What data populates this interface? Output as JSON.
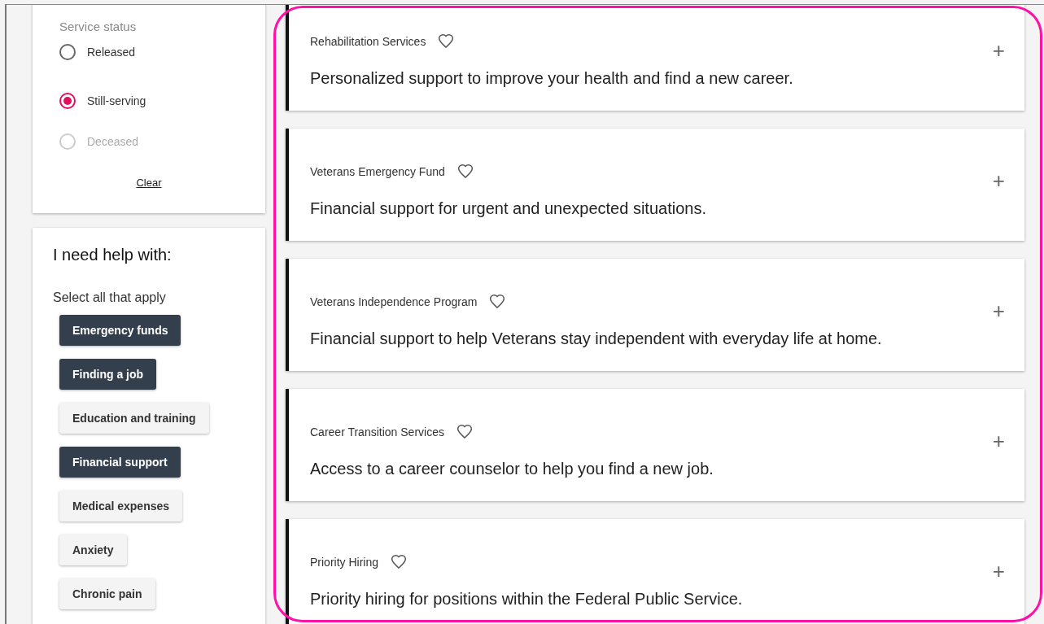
{
  "service_status": {
    "label": "Service status",
    "options": [
      {
        "label": "Released",
        "selected": false,
        "disabled": false
      },
      {
        "label": "Still-serving",
        "selected": true,
        "disabled": false
      },
      {
        "label": "Deceased",
        "selected": false,
        "disabled": true
      }
    ],
    "clear": "Clear"
  },
  "help": {
    "title": "I need help with:",
    "hint": "Select all that apply",
    "chips": [
      {
        "label": "Emergency funds",
        "selected": true
      },
      {
        "label": "Finding a job",
        "selected": true
      },
      {
        "label": "Education and training",
        "selected": false
      },
      {
        "label": "Financial support",
        "selected": true
      },
      {
        "label": "Medical expenses",
        "selected": false
      },
      {
        "label": "Anxiety",
        "selected": false
      },
      {
        "label": "Chronic pain",
        "selected": false
      }
    ]
  },
  "results": [
    {
      "title": "Rehabilitation Services",
      "favorite": false,
      "description": "Personalized support to improve your health and find a new career.",
      "expand": "+"
    },
    {
      "title": "Veterans Emergency Fund",
      "favorite": false,
      "description": "Financial support for urgent and unexpected situations.",
      "expand": "+"
    },
    {
      "title": "Veterans Independence Program",
      "favorite": false,
      "description": "Financial support to help Veterans stay independent with everyday life at home.",
      "expand": "+"
    },
    {
      "title": "Career Transition Services",
      "favorite": false,
      "description": "Access to a career counselor to help you find a new job.",
      "expand": "+"
    },
    {
      "title": "Priority Hiring",
      "favorite": false,
      "description": "Priority hiring for positions within the Federal Public Service.",
      "expand": "+"
    }
  ]
}
